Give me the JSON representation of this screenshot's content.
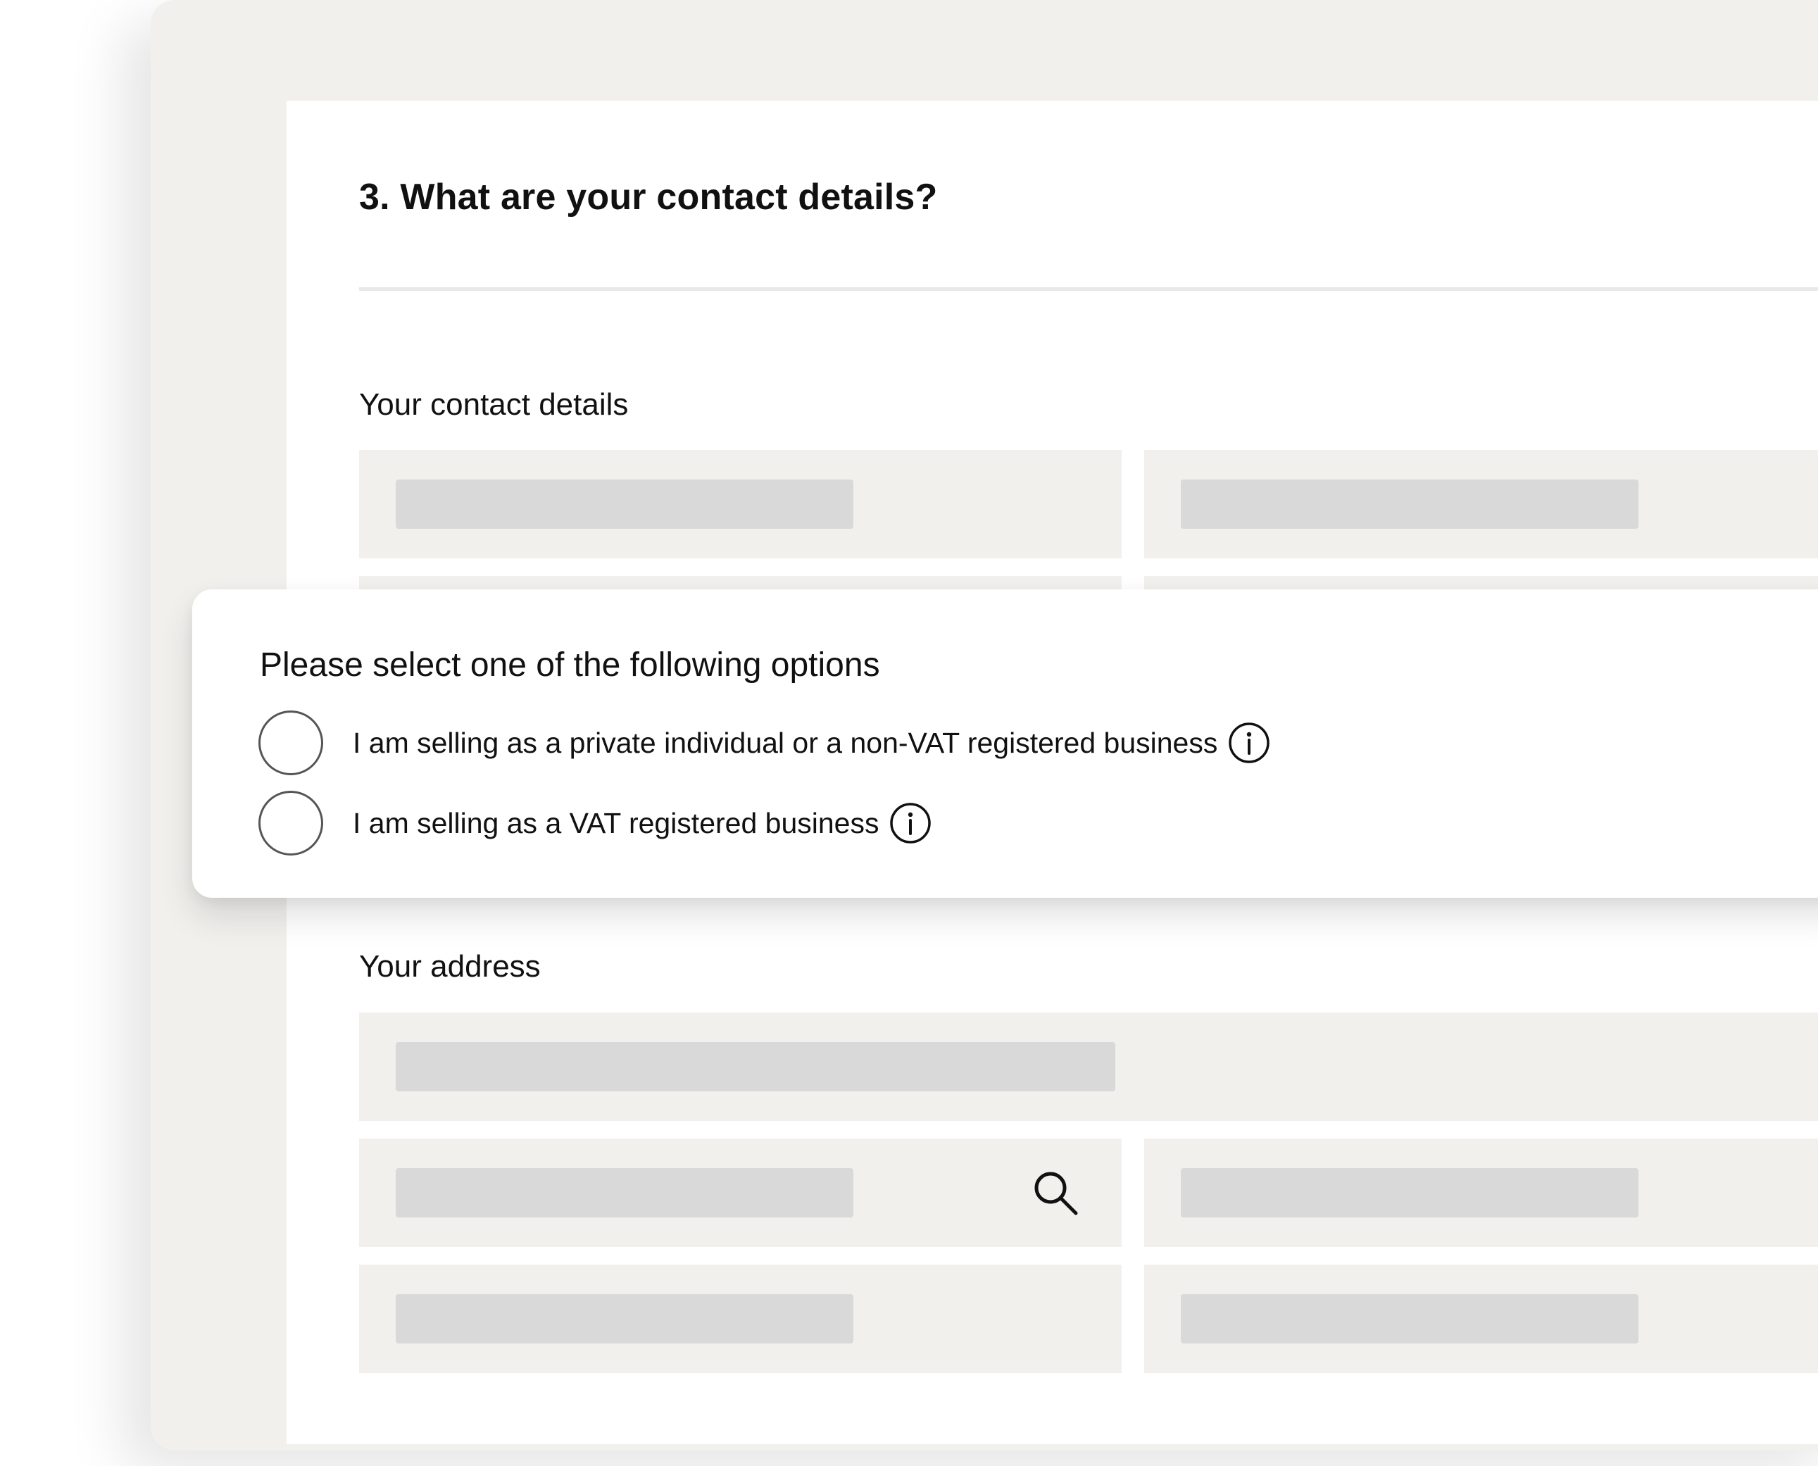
{
  "form": {
    "heading": "3. What are your contact details?",
    "contact_section_label": "Your contact details",
    "address_section_label": "Your address"
  },
  "seller_type_popup": {
    "title": "Please select one of the following options",
    "options": [
      {
        "label": "I am selling as a private individual or a non-VAT registered business",
        "selected": false,
        "icon": "info-icon"
      },
      {
        "label": "I am selling as a VAT registered business",
        "selected": false,
        "icon": "info-icon"
      }
    ]
  },
  "icons": {
    "address_lookup": "search-icon"
  },
  "colors": {
    "window_background": "#f1f0ed",
    "card_background": "#ffffff",
    "field_background": "#f1f0ed",
    "placeholder_bar": "#d9d9d9",
    "text": "#111111"
  }
}
